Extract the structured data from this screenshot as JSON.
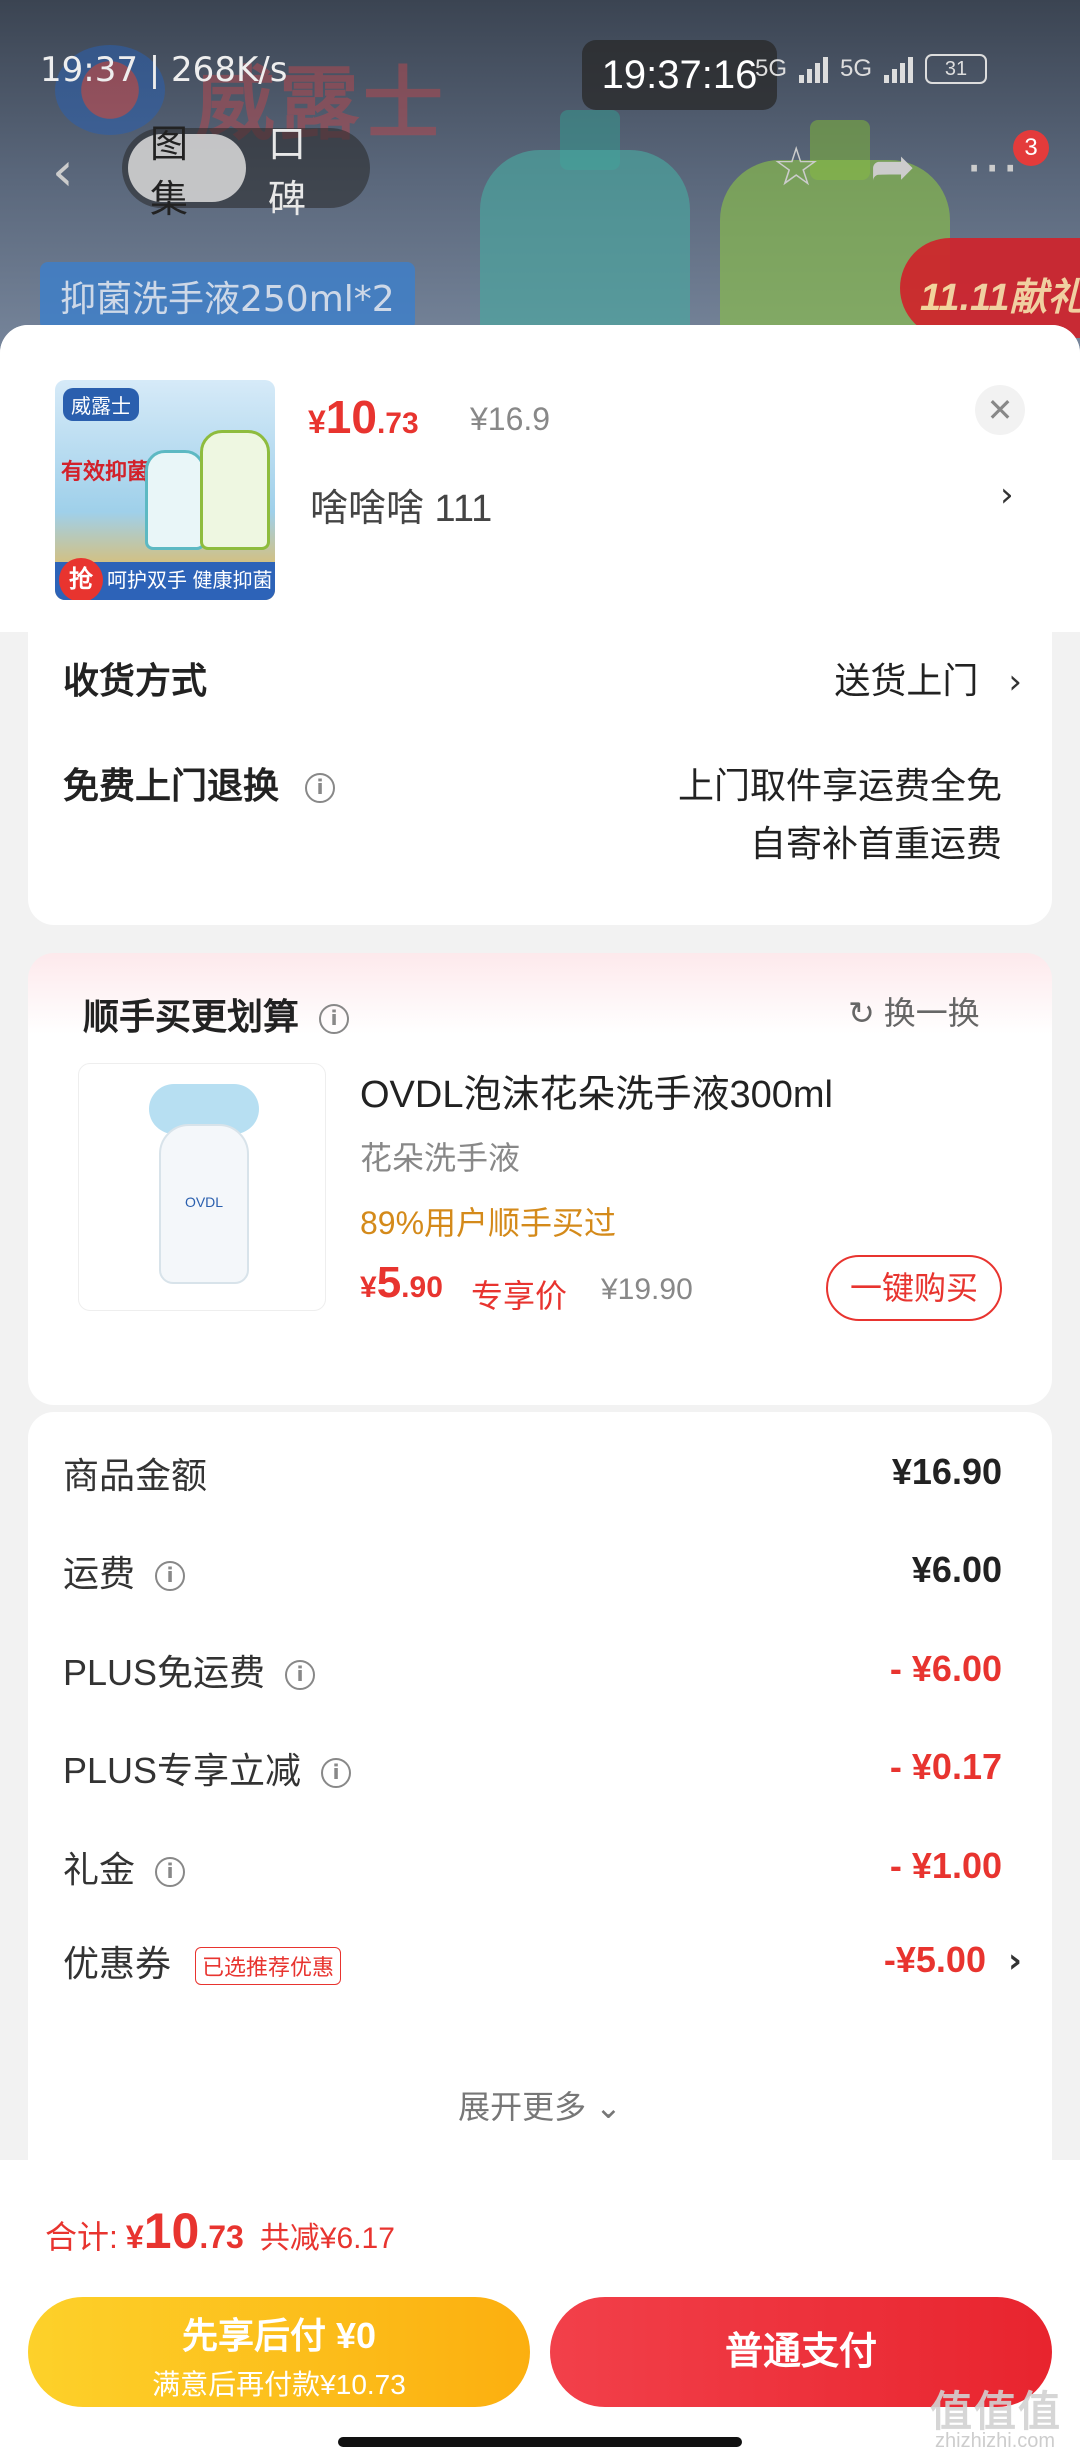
{
  "status_bar": {
    "left_text": "19:37 | 268K/s",
    "time": "19:37:16",
    "network": "5G",
    "battery": "31"
  },
  "hero": {
    "brand": "威露士",
    "banner_text": "抑菌洗手液250ml*2",
    "badge_text": "11.11献礼",
    "tabs": [
      "图集",
      "口碑"
    ],
    "message_count": "3"
  },
  "product": {
    "price_symbol": "¥",
    "price_int": "10",
    "price_dec": ".73",
    "original_price": "¥16.9",
    "spec": "啥啥啥  111",
    "thumb": {
      "logo": "威露士",
      "red_text": "有效抑菌 99.9%",
      "bar_text": "呵护双手 健康抑菌",
      "badge": "抢"
    }
  },
  "delivery": {
    "method_label": "收货方式",
    "method_value": "送货上门",
    "return_label": "免费上门退换",
    "return_line1": "上门取件享运费全免",
    "return_line2": "自寄补首重运费"
  },
  "upsell": {
    "title": "顺手买更划算",
    "swap_label": "换一换",
    "name": "OVDL泡沫花朵洗手液300ml",
    "subtitle": "花朵洗手液",
    "social_proof": "89%用户顺手买过",
    "price_symbol": "¥",
    "price_int": "5",
    "price_dec": ".90",
    "exclusive_label": "专享价",
    "original_price": "¥19.90",
    "buy_button": "一键购买"
  },
  "summary": {
    "rows": [
      {
        "label": "商品金额",
        "value": "¥16.90"
      },
      {
        "label": "运费",
        "value": "¥6.00"
      },
      {
        "label": "PLUS免运费",
        "value": "- ¥6.00"
      },
      {
        "label": "PLUS专享立减",
        "value": "- ¥0.17"
      },
      {
        "label": "礼金",
        "value": "- ¥1.00"
      },
      {
        "label": "优惠券",
        "value": "-¥5.00",
        "tag": "已选推荐优惠"
      }
    ],
    "expand_label": "展开更多"
  },
  "footer": {
    "total_label": "合计:",
    "total_symbol": "¥",
    "total_int": "10",
    "total_dec": ".73",
    "total_saved": "共减¥6.17",
    "pay_later_title": "先享后付 ¥0",
    "pay_later_sub": "满意后再付款¥10.73",
    "pay_button": "普通支付"
  },
  "watermark": {
    "text": "值值值",
    "url": "zhizhizhi.com"
  },
  "colors": {
    "accent_red": "#e8342f",
    "gold": "#fcaf0f"
  }
}
